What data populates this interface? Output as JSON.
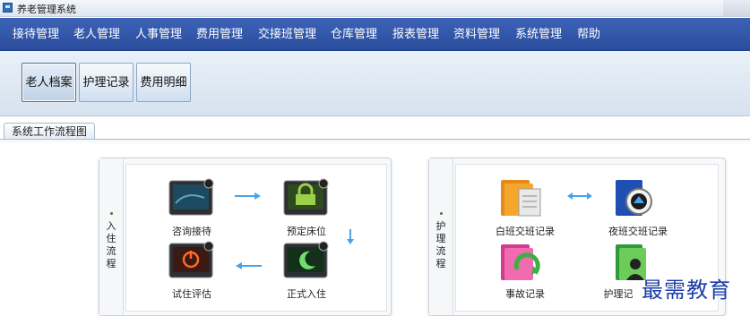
{
  "window": {
    "title": "养老管理系统"
  },
  "menu": [
    "接待管理",
    "老人管理",
    "人事管理",
    "费用管理",
    "交接班管理",
    "仓库管理",
    "报表管理",
    "资料管理",
    "系统管理",
    "帮助"
  ],
  "toolbar": {
    "buttons": [
      "老人档案",
      "护理记录",
      "费用明细"
    ]
  },
  "panel": {
    "tab": "系统工作流程图"
  },
  "admission_flow": {
    "label_chars": [
      "入",
      "住",
      "流",
      "程"
    ],
    "nodes": [
      "咨询接待",
      "预定床位",
      "试住评估",
      "正式入住"
    ]
  },
  "nursing_flow": {
    "label_chars": [
      "护",
      "理",
      "流",
      "程"
    ],
    "nodes": [
      "白班交班记录",
      "夜班交班记录",
      "事故记录",
      "护理记"
    ]
  },
  "watermark": "最需教育",
  "colors": {
    "menubar": "#2f56a8",
    "arrow": "#4aa3e8",
    "watermark": "#1c3ea8"
  }
}
